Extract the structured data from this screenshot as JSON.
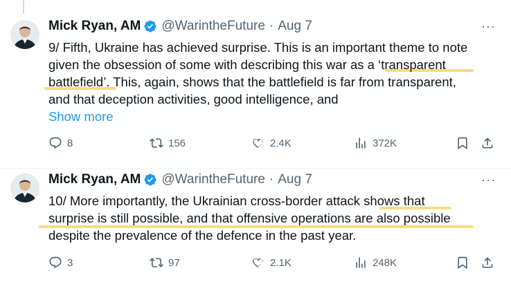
{
  "tweets": [
    {
      "author": "Mick Ryan, AM",
      "handle": "@WarintheFuture",
      "separator": "·",
      "date": "Aug 7",
      "more": "···",
      "lines": [
        "9/ Fifth, Ukraine has achieved surprise. This is an important theme to note",
        "given the obsession of some with describing this war as a ‘transparent",
        "battlefield’. This, again, shows that the battlefield is far from transparent,",
        "and that deception activities, good intelligence, and"
      ],
      "show_more": "Show more",
      "replies": "8",
      "reposts": "156",
      "likes": "2.4K",
      "views": "372K"
    },
    {
      "author": "Mick Ryan, AM",
      "handle": "@WarintheFuture",
      "separator": "·",
      "date": "Aug 7",
      "more": "···",
      "lines": [
        "10/ More importantly, the Ukrainian cross-border attack shows that",
        "surprise is still possible, and that offensive operations are also possible",
        "despite the prevalence of the defence in the past year."
      ],
      "replies": "3",
      "reposts": "97",
      "likes": "2.1K",
      "views": "248K"
    }
  ],
  "colors": {
    "accent": "#1d9bf0",
    "muted": "#536471",
    "highlight": "#f7d774"
  },
  "icons": [
    "verified-badge-icon",
    "more-icon",
    "reply-icon",
    "repost-icon",
    "like-icon",
    "views-icon",
    "bookmark-icon",
    "share-icon"
  ]
}
